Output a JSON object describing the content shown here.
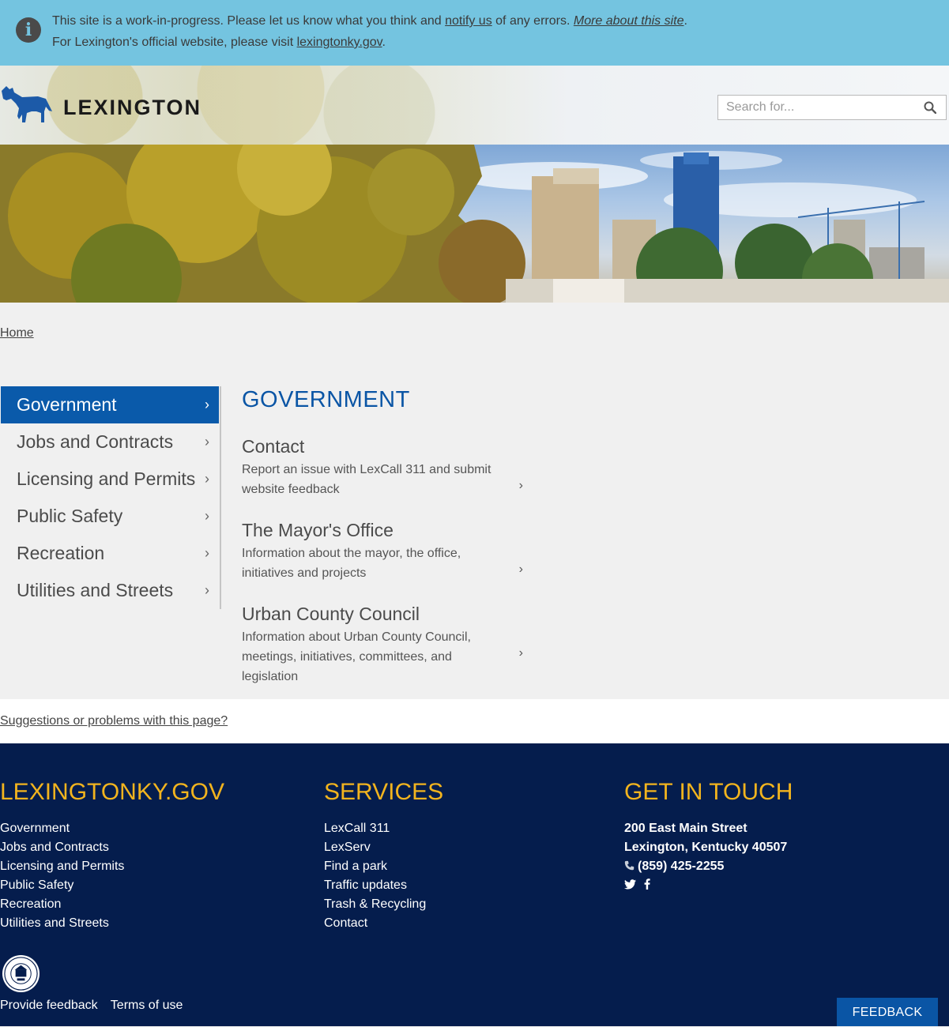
{
  "notice": {
    "line1_prefix": "This site is a work-in-progress. Please let us know what you think and ",
    "notify_link": "notify us",
    "line1_middle": " of any errors. ",
    "about_link": "More about this site",
    "line1_suffix": ".",
    "line2_prefix": "For Lexington's official website, please visit ",
    "official_link": "lexingtonky.gov",
    "line2_suffix": "."
  },
  "header": {
    "logo_text": "LEXINGTON",
    "search_placeholder": "Search for..."
  },
  "breadcrumb": {
    "home": "Home"
  },
  "sidebar": {
    "items": [
      {
        "label": "Government",
        "active": true
      },
      {
        "label": "Jobs and Contracts"
      },
      {
        "label": "Licensing and Permits"
      },
      {
        "label": "Public Safety"
      },
      {
        "label": "Recreation"
      },
      {
        "label": "Utilities and Streets"
      }
    ],
    "chevron": "›"
  },
  "main": {
    "title": "GOVERNMENT",
    "cards": [
      {
        "title": "Contact",
        "description": "Report an issue with LexCall 311 and submit website feedback"
      },
      {
        "title": "The Mayor's Office",
        "description": "Information about the mayor, the office, initiatives and projects"
      },
      {
        "title": "Urban County Council",
        "description": "Information about Urban County Council, meetings, initiatives, committees, and legislation"
      }
    ]
  },
  "suggest": {
    "link": "Suggestions or problems with this page?"
  },
  "footer": {
    "col1": {
      "heading": "LEXINGTONKY.GOV",
      "links": [
        "Government",
        "Jobs and Contracts",
        "Licensing and Permits",
        "Public Safety",
        "Recreation",
        "Utilities and Streets"
      ]
    },
    "col2": {
      "heading": "SERVICES",
      "links": [
        "LexCall 311",
        "LexServ",
        "Find a park",
        "Traffic updates",
        "Trash & Recycling",
        "Contact"
      ]
    },
    "col3": {
      "heading": "GET IN TOUCH",
      "address1": "200 East Main Street",
      "address2": "Lexington, Kentucky 40507",
      "phone": "(859) 425-2255"
    },
    "provide_feedback": "Provide feedback",
    "terms": "Terms of use",
    "feedback_button": "FEEDBACK",
    "seal_text": "LEXINGTON FAYETTE URBAN COUNTY GOVERNMENT 1775"
  },
  "colors": {
    "notice_bg": "#74c4e0",
    "brand_blue": "#0a5aaa",
    "footer_bg": "#051d4d",
    "footer_heading": "#f2b41e"
  }
}
